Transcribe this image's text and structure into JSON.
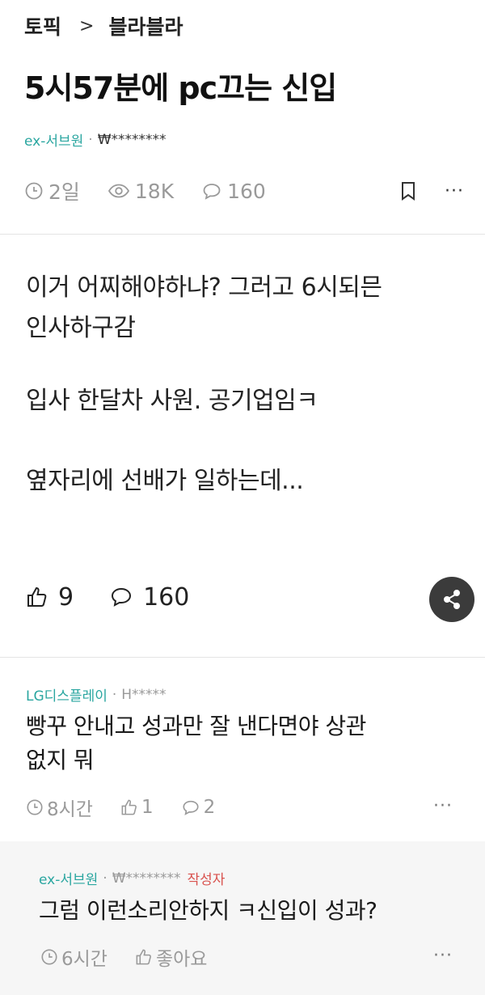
{
  "breadcrumb": {
    "section": "토픽",
    "separator": ">",
    "topic": "블라블라"
  },
  "post": {
    "title": "5시57분에 pc끄는 신입",
    "author": {
      "company": "ex-서브원",
      "separator": "·",
      "nickname": "₩********"
    },
    "meta": {
      "age": "2일",
      "views": "18K",
      "comments": "160"
    },
    "more": "···",
    "body": [
      "이거 어찌해야하냐? 그러고 6시되믄",
      "인사하구감",
      "입사 한달차 사원. 공기업임ㅋ",
      "옆자리에 선배가 일하는데..."
    ],
    "likes": "9",
    "comment_count": "160"
  },
  "comments": [
    {
      "company": "LG디스플레이",
      "separator": "·",
      "nickname": "H*****",
      "text": [
        "빵꾸 안내고 성과만 잘 낸다면야 상관",
        "없지 뭐"
      ],
      "age": "8시간",
      "likes": "1",
      "replies": "2",
      "more": "···"
    }
  ],
  "reply": {
    "company": "ex-서브원",
    "separator": "·",
    "nickname": "₩********",
    "author_tag": "작성자",
    "text": "그럼 이런소리안하지 ㅋ신입이 성과?",
    "age": "6시간",
    "like_label": "좋아요",
    "more": "···"
  },
  "colors": {
    "company": "#2aa6a0",
    "author_tag": "#d9534f",
    "share_bg": "#3b3b3b",
    "meta": "#9a9a9a"
  }
}
